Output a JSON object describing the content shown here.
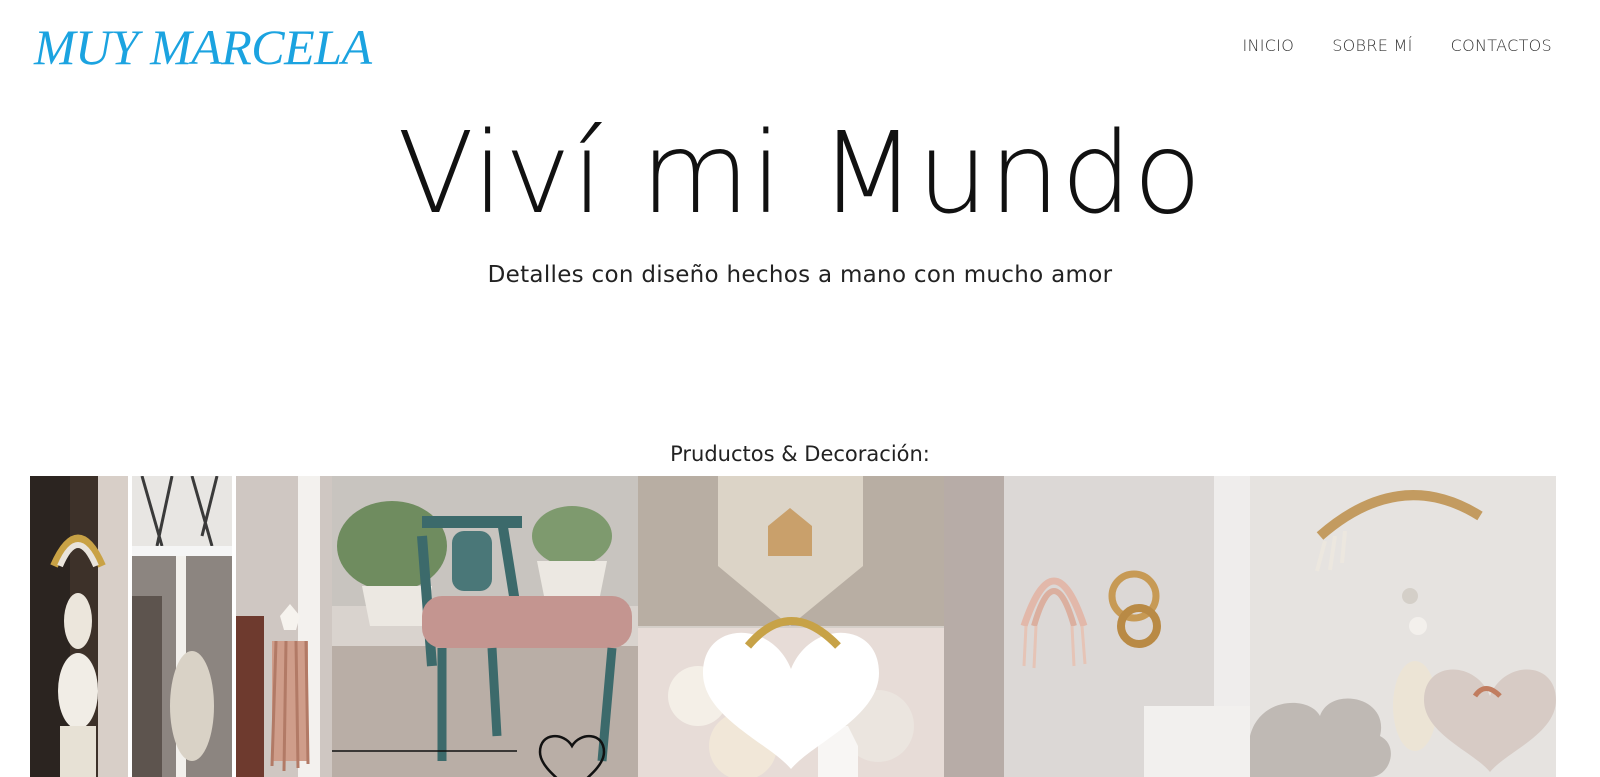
{
  "brand": {
    "logo_text": "MUY MARCELA",
    "color": "#1ba3e0"
  },
  "nav": {
    "items": [
      {
        "label": "INICIO"
      },
      {
        "label": "SOBRE MÍ"
      },
      {
        "label": "CONTACTOS"
      }
    ]
  },
  "hero": {
    "title": "Viví mi Mundo",
    "subtitle": "Detalles con diseño hechos a mano con mucho amor"
  },
  "products": {
    "title": "Pruductos & Decoración:",
    "images": [
      {
        "icon": "macrame-rainbow-hanging-photo"
      },
      {
        "icon": "lamp-with-macrame-photo"
      },
      {
        "icon": "tassel-hanging-photo"
      },
      {
        "icon": "chair-with-cushion-photo"
      },
      {
        "icon": "knit-heart-collage-photo"
      },
      {
        "icon": "wall-rainbows-photo"
      },
      {
        "icon": "cloud-heart-mobile-photo"
      }
    ]
  }
}
